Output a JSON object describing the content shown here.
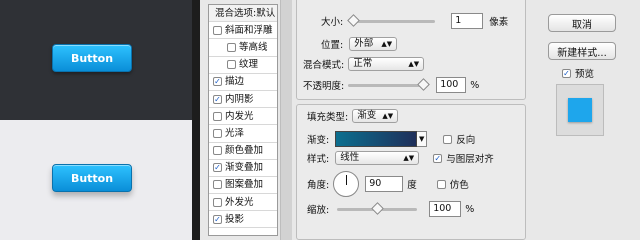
{
  "preview": {
    "dark_button": "Button",
    "light_button": "Button"
  },
  "styles_list": [
    {
      "label": "混合选项:默认",
      "checked": null,
      "indent": false,
      "head": true
    },
    {
      "label": "斜面和浮雕",
      "checked": false,
      "indent": false
    },
    {
      "label": "等高线",
      "checked": false,
      "indent": true
    },
    {
      "label": "纹理",
      "checked": false,
      "indent": true
    },
    {
      "label": "描边",
      "checked": true,
      "indent": false
    },
    {
      "label": "内阴影",
      "checked": true,
      "indent": false
    },
    {
      "label": "内发光",
      "checked": false,
      "indent": false
    },
    {
      "label": "光泽",
      "checked": false,
      "indent": false
    },
    {
      "label": "颜色叠加",
      "checked": false,
      "indent": false
    },
    {
      "label": "渐变叠加",
      "checked": true,
      "indent": false
    },
    {
      "label": "图案叠加",
      "checked": false,
      "indent": false
    },
    {
      "label": "外发光",
      "checked": false,
      "indent": false
    },
    {
      "label": "投影",
      "checked": true,
      "indent": false
    }
  ],
  "stroke": {
    "size_label": "大小:",
    "size_value": "1",
    "size_unit": "像素",
    "size_slider": 0.02,
    "position_label": "位置:",
    "position_value": "外部",
    "blend_label": "混合模式:",
    "blend_value": "正常",
    "opacity_label": "不透明度:",
    "opacity_value": "100",
    "opacity_unit": "%",
    "opacity_slider": 1.0
  },
  "fill": {
    "type_label": "填充类型:",
    "type_value": "渐变",
    "gradient_label": "渐变:",
    "reverse_label": "反向",
    "reverse_checked": false,
    "style_label": "样式:",
    "style_value": "线性",
    "align_label": "与图层对齐",
    "align_checked": true,
    "angle_label": "角度:",
    "angle_value": "90",
    "angle_unit": "度",
    "dither_label": "仿色",
    "dither_checked": false,
    "scale_label": "缩放:",
    "scale_value": "100",
    "scale_unit": "%",
    "scale_slider": 0.5
  },
  "actions": {
    "cancel": "取消",
    "new_style": "新建样式...",
    "preview_label": "预览",
    "preview_checked": true
  },
  "colors": {
    "accent": "#1ea6ec",
    "gradient_start": "#0c6f8f",
    "gradient_end": "#1f2f5a"
  }
}
